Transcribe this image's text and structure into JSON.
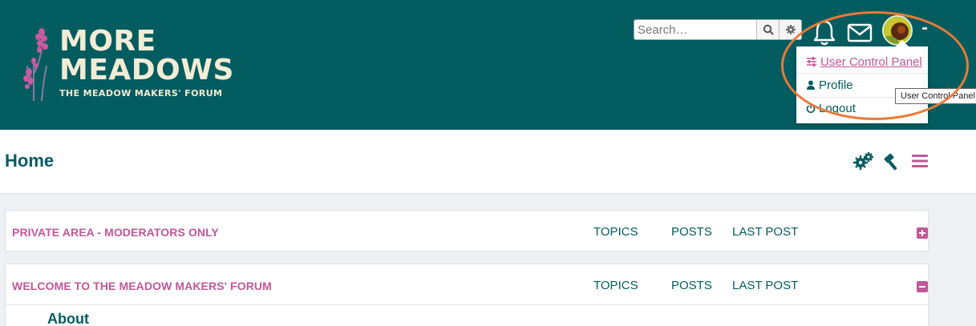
{
  "logo": {
    "title_line1": "MORE",
    "title_line2": "MEADOWS",
    "subtitle": "THE MEADOW MAKERS' FORUM"
  },
  "search": {
    "placeholder": "Search…"
  },
  "user_menu": {
    "items": [
      {
        "label": "User Control Panel",
        "icon": "sliders-icon"
      },
      {
        "label": "Profile",
        "icon": "user-icon"
      },
      {
        "label": "Logout",
        "icon": "power-icon"
      }
    ],
    "tooltip": "User Control Panel"
  },
  "header_icons": [
    "bell-icon",
    "envelope-icon",
    "avatar"
  ],
  "navbar": {
    "title": "Home",
    "icons": [
      "gears-icon",
      "gavel-icon",
      "hamburger-icon"
    ]
  },
  "forums": [
    {
      "name": "PRIVATE AREA - MODERATORS ONLY",
      "topics_label": "TOPICS",
      "posts_label": "POSTS",
      "last_post_label": "LAST POST",
      "toggle": "expand"
    },
    {
      "name": "WELCOME TO THE MEADOW MAKERS' FORUM",
      "topics_label": "TOPICS",
      "posts_label": "POSTS",
      "last_post_label": "LAST POST",
      "toggle": "collapse",
      "first_item": "About"
    }
  ],
  "colors": {
    "header_bg": "#035c60",
    "accent_pink": "#c0579a",
    "teal_text": "#035c60",
    "annotation_orange": "#ea7a36"
  }
}
